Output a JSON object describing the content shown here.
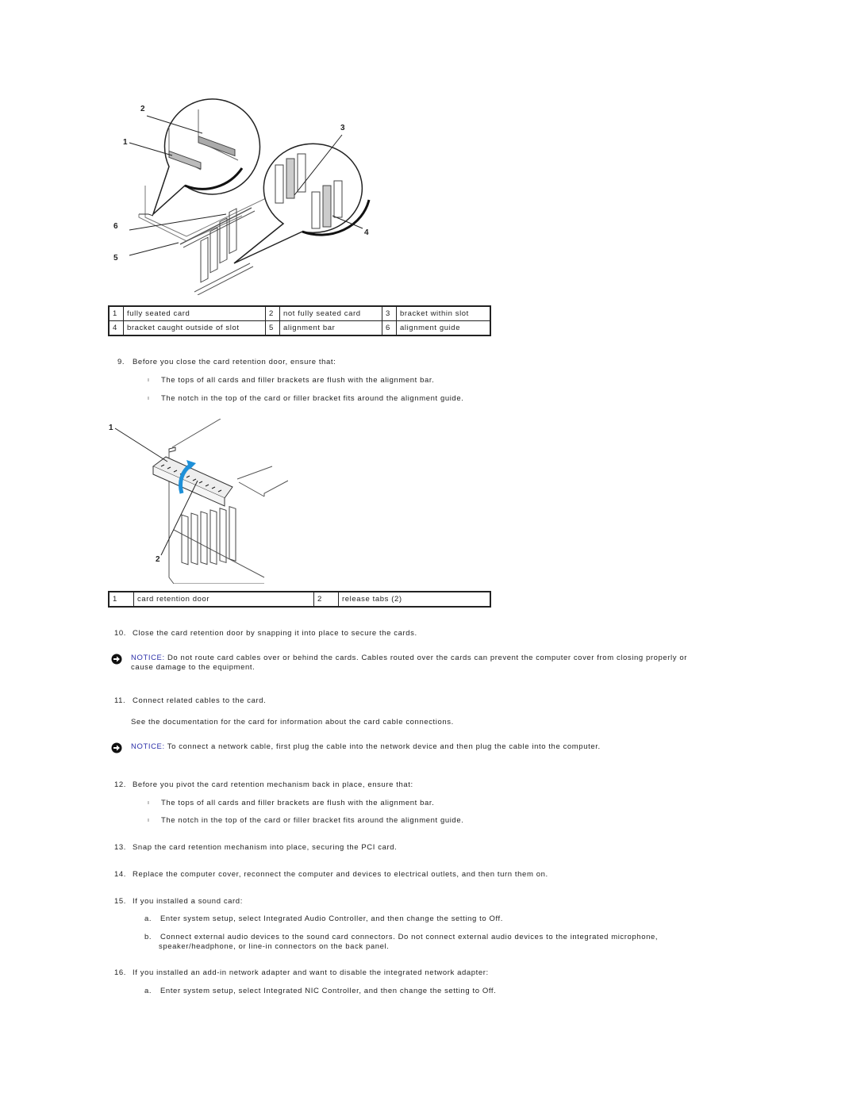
{
  "figure1": {
    "callouts": [
      "1",
      "2",
      "3",
      "4",
      "5",
      "6"
    ]
  },
  "legend1": {
    "rows": [
      [
        {
          "num": "1",
          "label": "fully seated card"
        },
        {
          "num": "2",
          "label": "not fully seated card"
        },
        {
          "num": "3",
          "label": "bracket within slot"
        }
      ],
      [
        {
          "num": "4",
          "label": "bracket caught outside of slot"
        },
        {
          "num": "5",
          "label": "alignment bar"
        },
        {
          "num": "6",
          "label": "alignment guide"
        }
      ]
    ]
  },
  "step9": {
    "num": "9.",
    "text": "Before you close the card retention door, ensure that:",
    "bullets": [
      "The tops of all cards and filler brackets are flush with the alignment bar.",
      "The notch in the top of the card or filler bracket fits around the alignment guide."
    ]
  },
  "figure2": {
    "callouts": [
      "1",
      "2"
    ],
    "arrow_color": "#1e90d8"
  },
  "legend2": {
    "rows": [
      [
        {
          "num": "1",
          "label": "card retention door"
        },
        {
          "num": "2",
          "label": "release tabs (2)"
        }
      ]
    ]
  },
  "step10": {
    "num": "10.",
    "text": "Close the card retention door by snapping it into place to secure the cards."
  },
  "notice1": {
    "label": "NOTICE:",
    "text_line1": " Do not route card cables over or behind the cards. Cables routed over the cards can prevent the computer cover from closing properly or",
    "text_line2": "cause damage to the equipment."
  },
  "step11": {
    "num": "11.",
    "text": "Connect related cables to the card.",
    "detail": "See the documentation for the card for information about the card cable connections."
  },
  "notice2": {
    "label": "NOTICE:",
    "text": " To connect a network cable, first plug the cable into the network device and then plug the cable into the computer."
  },
  "step12": {
    "num": "12.",
    "text": "Before you pivot the card retention mechanism back in place, ensure that:",
    "bullets": [
      "The tops of all cards and filler brackets are flush with the alignment bar.",
      "The notch in the top of the card or filler bracket fits around the alignment guide."
    ]
  },
  "step13": {
    "num": "13.",
    "text": "Snap the card retention mechanism into place, securing the PCI card."
  },
  "step14": {
    "num": "14.",
    "text": "Replace the computer cover, reconnect the computer and devices to electrical outlets, and then turn them on."
  },
  "step15": {
    "num": "15.",
    "text": "If you installed a sound card:",
    "substeps": [
      {
        "letter": "a.",
        "text": "Enter system setup, select Integrated Audio Controller, and then change the setting to Off."
      },
      {
        "letter": "b.",
        "text_line1": "Connect external audio devices to the sound card connectors. Do not connect external audio devices to the integrated microphone,",
        "text_line2": "speaker/headphone, or line-in connectors on the back panel."
      }
    ]
  },
  "step16": {
    "num": "16.",
    "text": "If you installed an add-in network adapter and want to disable the integrated network adapter:",
    "substeps": [
      {
        "letter": "a.",
        "text": "Enter system setup, select Integrated NIC Controller, and then change the setting to Off."
      }
    ]
  },
  "colors": {
    "notice_label": "#2b2fa8",
    "text": "#222222"
  }
}
